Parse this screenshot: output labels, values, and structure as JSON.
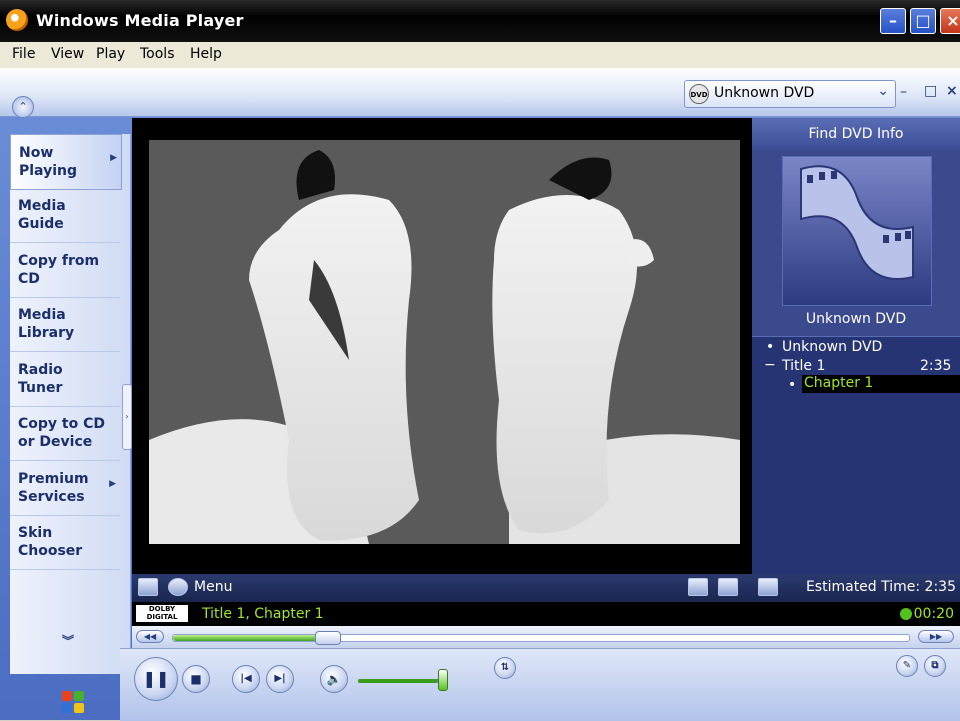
{
  "window": {
    "title": "Windows Media Player"
  },
  "menu": [
    "File",
    "View",
    "Play",
    "Tools",
    "Help"
  ],
  "selector": {
    "label": "Unknown DVD"
  },
  "nav": {
    "items": [
      {
        "label": "Now Playing"
      },
      {
        "label": "Media Guide"
      },
      {
        "label": "Copy from CD"
      },
      {
        "label": "Media Library"
      },
      {
        "label": "Radio Tuner"
      },
      {
        "label": "Copy to CD or Device"
      },
      {
        "label": "Premium Services"
      },
      {
        "label": "Skin Chooser"
      }
    ]
  },
  "panel": {
    "find_label": "Find DVD Info",
    "art_title": "Unknown DVD",
    "tree": {
      "disc": "Unknown DVD",
      "title": "Title 1",
      "title_time": "2:35",
      "chapter": "Chapter 1"
    }
  },
  "toolbar": {
    "menu_label": "Menu",
    "estimated_time": "Estimated Time: 2:35"
  },
  "status": {
    "dolby": "DOLBY DIGITAL",
    "text": "Title 1, Chapter 1",
    "time": "00:20"
  },
  "playback": {
    "seek_fraction": 0.21,
    "volume_fraction": 0.9
  },
  "colors": {
    "status_green": "#9ee52b",
    "panel_blue": "#3a4a8c",
    "frame_blue": "#4b6dc2"
  }
}
